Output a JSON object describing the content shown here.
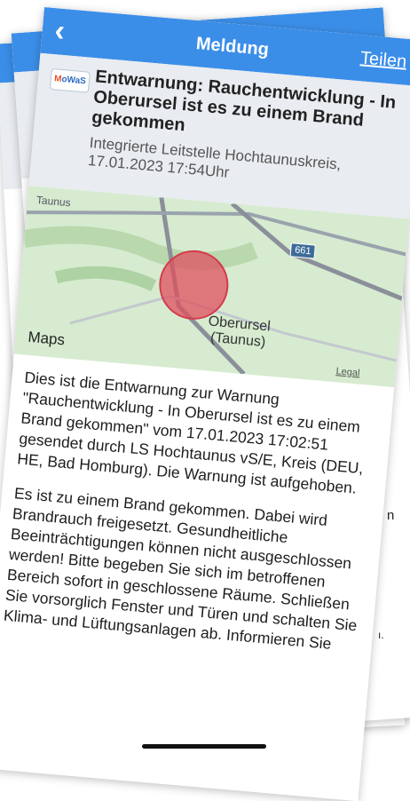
{
  "nav": {
    "back_icon": "chevron-left-icon",
    "title": "Meldung",
    "share_label": "Teilen"
  },
  "message": {
    "logo_text": "MoWaS",
    "headline": "Entwarnung: Rauchentwicklung - In Oberursel ist es zu einem Brand gekommen",
    "sender": "Integrierte Leitstelle Hochtaunuskreis, 17.01.2023 17:54Uhr"
  },
  "map": {
    "place_label": "Oberursel (Taunus)",
    "region_label": "Taunus",
    "road_badge": "661",
    "maps_brand": "Maps",
    "legal_label": "Legal",
    "colors": {
      "land": "#d6ebcf",
      "road": "#9aa3ad",
      "highway": "#8a8f99",
      "marker": "#e0505f"
    }
  },
  "body": {
    "paragraph_1": "Dies ist die Entwarnung zur Warnung \"Rauchentwicklung - In Oberursel ist es zu einem Brand gekommen\" vom 17.01.2023 17:02:51 gesendet durch LS Hochtaunus vS/E, Kreis (DEU, HE, Bad Homburg). Die Warnung ist aufgehoben.",
    "paragraph_2": "Es ist zu einem Brand gekommen. Dabei wird Brandrauch freigesetzt. Gesundheitliche Beeinträchtigungen können nicht ausgeschlossen werden! Bitte begeben Sie sich im betroffenen Bereich sofort in geschlossene Räume. Schließen Sie vorsorglich Fenster und Türen und schalten Sie Klima- und Lüftungsanlagen ab. Informieren Sie"
  },
  "side": {
    "n": "n",
    "dot": "ı."
  }
}
